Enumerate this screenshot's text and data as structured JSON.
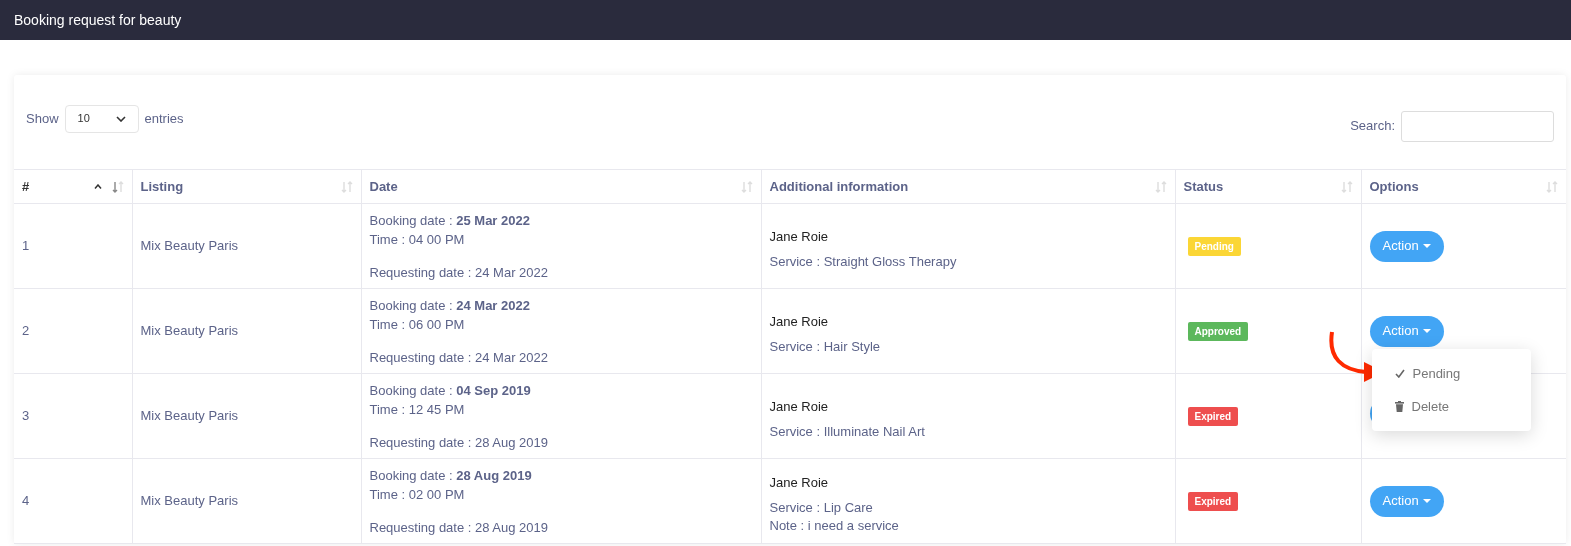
{
  "title": "Booking request for beauty",
  "length": {
    "before": "Show",
    "value": "10",
    "after": "entries"
  },
  "search": {
    "label": "Search:"
  },
  "columns": [
    {
      "label": "#",
      "sorted": true
    },
    {
      "label": "Listing",
      "sorted": false
    },
    {
      "label": "Date",
      "sorted": false
    },
    {
      "label": "Additional information",
      "sorted": false
    },
    {
      "label": "Status",
      "sorted": false
    },
    {
      "label": "Options",
      "sorted": false
    }
  ],
  "rows": [
    {
      "index": "1",
      "listing": "Mix Beauty Paris",
      "booking": "Booking date : **25 Mar 2022**",
      "time": "Time : 04 00 PM",
      "requesting": "Requesting date : 24 Mar 2022",
      "name": "Jane Roie",
      "details": [
        "Service : Straight Gloss Therapy"
      ],
      "status": {
        "label": "Pending",
        "color": "#fbd635"
      },
      "action": "Action"
    },
    {
      "index": "2",
      "listing": "Mix Beauty Paris",
      "booking": "Booking date : **24 Mar 2022**",
      "time": "Time : 06 00 PM",
      "requesting": "Requesting date : 24 Mar 2022",
      "name": "Jane Roie",
      "details": [
        "Service : Hair Style"
      ],
      "status": {
        "label": "Approved",
        "color": "#5cb85c"
      },
      "action": "Action",
      "menu": [
        {
          "kind": "check",
          "label": "Pending"
        },
        {
          "kind": "trash",
          "label": "Delete"
        }
      ]
    },
    {
      "index": "3",
      "listing": "Mix Beauty Paris",
      "booking": "Booking date : **04 Sep 2019**",
      "time": "Time : 12 45 PM",
      "requesting": "Requesting date : 28 Aug 2019",
      "name": "Jane Roie",
      "details": [
        "Service : Illuminate Nail Art"
      ],
      "status": {
        "label": "Expired",
        "color": "#ee4e4e"
      }
    },
    {
      "index": "4",
      "listing": "Mix Beauty Paris",
      "booking": "Booking date : **28 Aug 2019**",
      "time": "Time : 02 00 PM",
      "requesting": "Requesting date : 28 Aug 2019",
      "name": "Jane Roie",
      "details": [
        "Service : Lip Care",
        "Note : i need a service"
      ],
      "status": {
        "label": "Expired",
        "color": "#ee4e4e"
      },
      "action": "Action"
    }
  ]
}
